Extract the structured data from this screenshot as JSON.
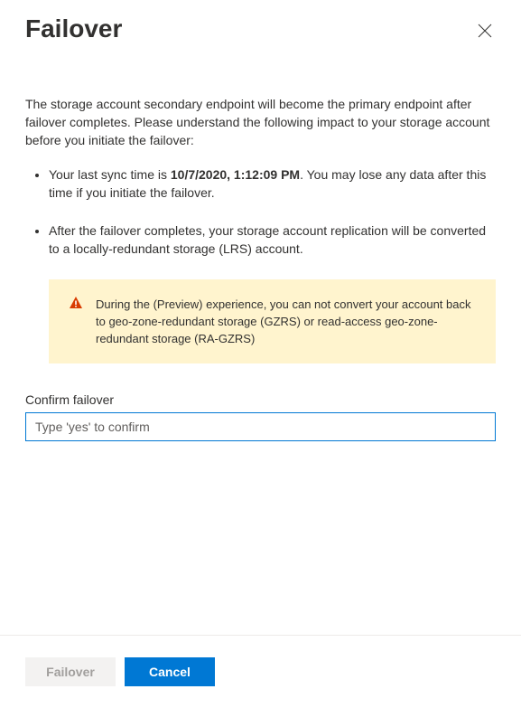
{
  "title": "Failover",
  "description": "The storage account secondary endpoint will become the primary endpoint after failover completes. Please understand the following impact to your storage account before you initiate the failover:",
  "bullet1": {
    "prefix": "Your last sync time is ",
    "sync_time": "10/7/2020, 1:12:09 PM",
    "suffix": ". You may lose any data after this time if you initiate the failover."
  },
  "bullet2": "After the failover completes, your storage account replication will be converted to a locally-redundant storage (LRS) account.",
  "warning": "During the (Preview) experience, you can not convert your account back to geo-zone-redundant storage (GZRS) or read-access geo-zone-redundant storage (RA-GZRS)",
  "confirm": {
    "label": "Confirm failover",
    "placeholder": "Type 'yes' to confirm"
  },
  "buttons": {
    "failover": "Failover",
    "cancel": "Cancel"
  }
}
